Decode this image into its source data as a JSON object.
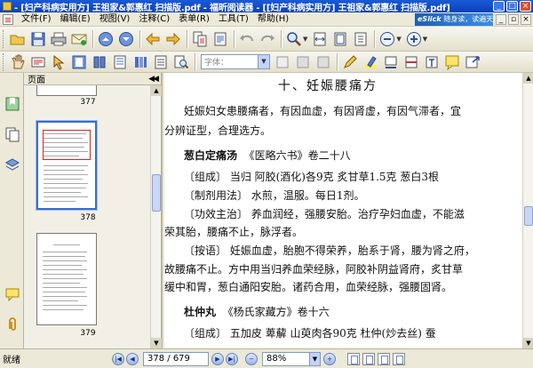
{
  "window": {
    "title": "- [妇产科病实用方] 王祖家&郭惠红 扫描版.pdf - 福昕阅读器 - [[妇产科病实用方] 王祖家&郭惠红 扫描版.pdf]"
  },
  "menu": {
    "items": [
      "文件(F)",
      "编辑(E)",
      "视图(V)",
      "注释(C)",
      "表单(R)",
      "工具(T)",
      "帮助(H)"
    ],
    "banner_brand": "eSlick",
    "banner_text": "随身读，读遍天下书！"
  },
  "toolbar2": {
    "font_placeholder": "字体："
  },
  "panel": {
    "title": "页面",
    "thumbs": [
      {
        "label": "377"
      },
      {
        "label": "378"
      },
      {
        "label": "379"
      }
    ]
  },
  "document": {
    "heading": "十、妊娠腰痛方",
    "lines": [
      "妊娠妇女患腰痛者，有因血虚，有因肾虚，有因气滞者，宜",
      "分辨证型，合理选方。",
      "",
      "〔组成〕 当归  阿胶(酒化)各9克  炙甘草1.5克  葱白3根",
      "〔制剂用法〕 水煎，温服。每日1剂。",
      "〔功效主治〕 养血润经，强腰安胎。治疗孕妇血虚，不能滋",
      "荣其胎，腰痛不止，脉浮者。",
      "〔按语〕 妊娠血虚，胎胞不得荣养，胎系于肾，腰为肾之府，",
      "故腰痛不止。方中用当归养血荣经脉，阿胶补阴益肾府，炙甘草",
      "缓中和胃，葱白通阳安胎。诸药合用，血荣经脉，强腰固肾。",
      "",
      "〔组成〕 五加皮  萆薢  山萸肉各90克  杜仲(炒去丝)  蚕"
    ],
    "formula1_name": "葱白定痛汤",
    "formula1_source": "《医略六书》卷二十八",
    "formula2_name": "杜仲丸",
    "formula2_source": "《杨氏家藏方》卷十六"
  },
  "status": {
    "text": "就绪",
    "page_value": "378 / 679",
    "zoom_value": "88%"
  },
  "colors": {
    "titlebar": "#0b40b8",
    "chrome": "#ece9d8",
    "selection": "#3a6fc9"
  }
}
